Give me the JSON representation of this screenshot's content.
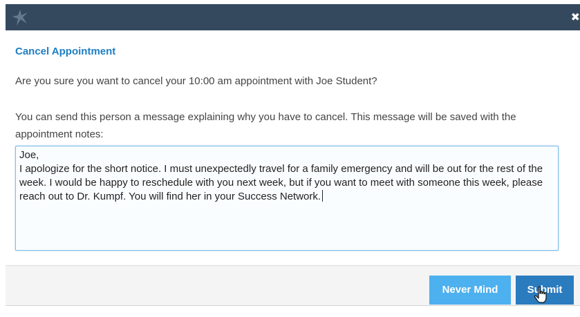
{
  "title_bar": {
    "logo_icon": "star-logo-icon",
    "close_icon": "close-icon",
    "close_symbol": "✖",
    "background": "#34495e"
  },
  "dialog": {
    "heading": "Cancel Appointment",
    "question": "Are you sure you want to cancel your 10:00 am appointment with Joe Student?",
    "explanation": "You can send this person a message explaining why you have to cancel. This message will be saved with the appointment notes:",
    "message_value": "Joe,\nI apologize for the short notice. I must unexpectedly travel for a family emergency and will be out for the rest of the week. I would be happy to reschedule with you next week, but if you want to meet with someone this week, please reach out to Dr. Kumpf. You will find her in your Success Network."
  },
  "buttons": {
    "never_mind": "Never Mind",
    "submit": "Submit"
  },
  "colors": {
    "heading": "#1e7fc3",
    "never_mind": "#4db0ef",
    "submit": "#2b7bbf"
  }
}
